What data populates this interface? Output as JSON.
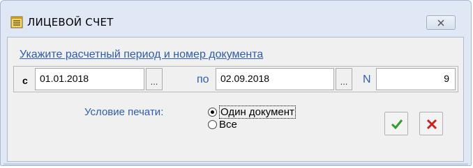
{
  "window": {
    "title": "ЛИЦЕВОЙ СЧЕТ",
    "title_icon": "document-list-icon",
    "close_icon": "close-icon"
  },
  "form": {
    "hint": "Укажите расчетный период и номер документа",
    "from_label": "с",
    "from_value": "01.01.2018",
    "to_label": "по",
    "to_value": "02.09.2018",
    "ellipsis": "...",
    "number_label": "N",
    "number_value": "9"
  },
  "print": {
    "label": "Условие печати:",
    "options": [
      "Один документ",
      "Все"
    ],
    "selected": "Один документ"
  },
  "actions": {
    "ok_icon": "checkmark-icon",
    "cancel_icon": "cross-icon",
    "ok_color": "#2e9b2e",
    "cancel_color": "#cc1f1f"
  }
}
